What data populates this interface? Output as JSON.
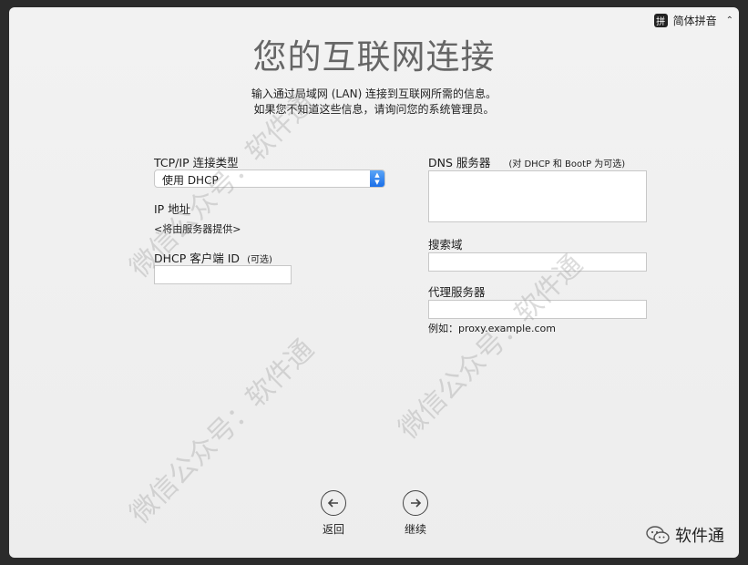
{
  "ime": {
    "badge": "拼",
    "label": "简体拼音"
  },
  "page": {
    "title": "您的互联网连接",
    "subtitle_line1": "输入通过局域网 (LAN) 连接到互联网所需的信息。",
    "subtitle_line2": "如果您不知道这些信息，请询问您的系统管理员。"
  },
  "left": {
    "tcp_label": "TCP/IP 连接类型",
    "tcp_value": "使用 DHCP",
    "ip_label": "IP 地址",
    "ip_value": "<将由服务器提供>",
    "dhcp_label": "DHCP 客户端 ID",
    "dhcp_note": "(可选)",
    "dhcp_value": ""
  },
  "right": {
    "dns_label": "DNS 服务器",
    "dns_note": "(对 DHCP 和 BootP 为可选)",
    "dns_value": "",
    "search_label": "搜索域",
    "search_value": "",
    "proxy_label": "代理服务器",
    "proxy_value": "",
    "proxy_example": "例如：proxy.example.com"
  },
  "nav": {
    "back": "返回",
    "continue": "继续"
  },
  "watermark": {
    "text_diag": "微信公众号：软件通",
    "brand": "软件通"
  },
  "colors": {
    "accent": "#1a6ee8",
    "window_bg": "#efefef",
    "frame": "#2b2b2b"
  }
}
